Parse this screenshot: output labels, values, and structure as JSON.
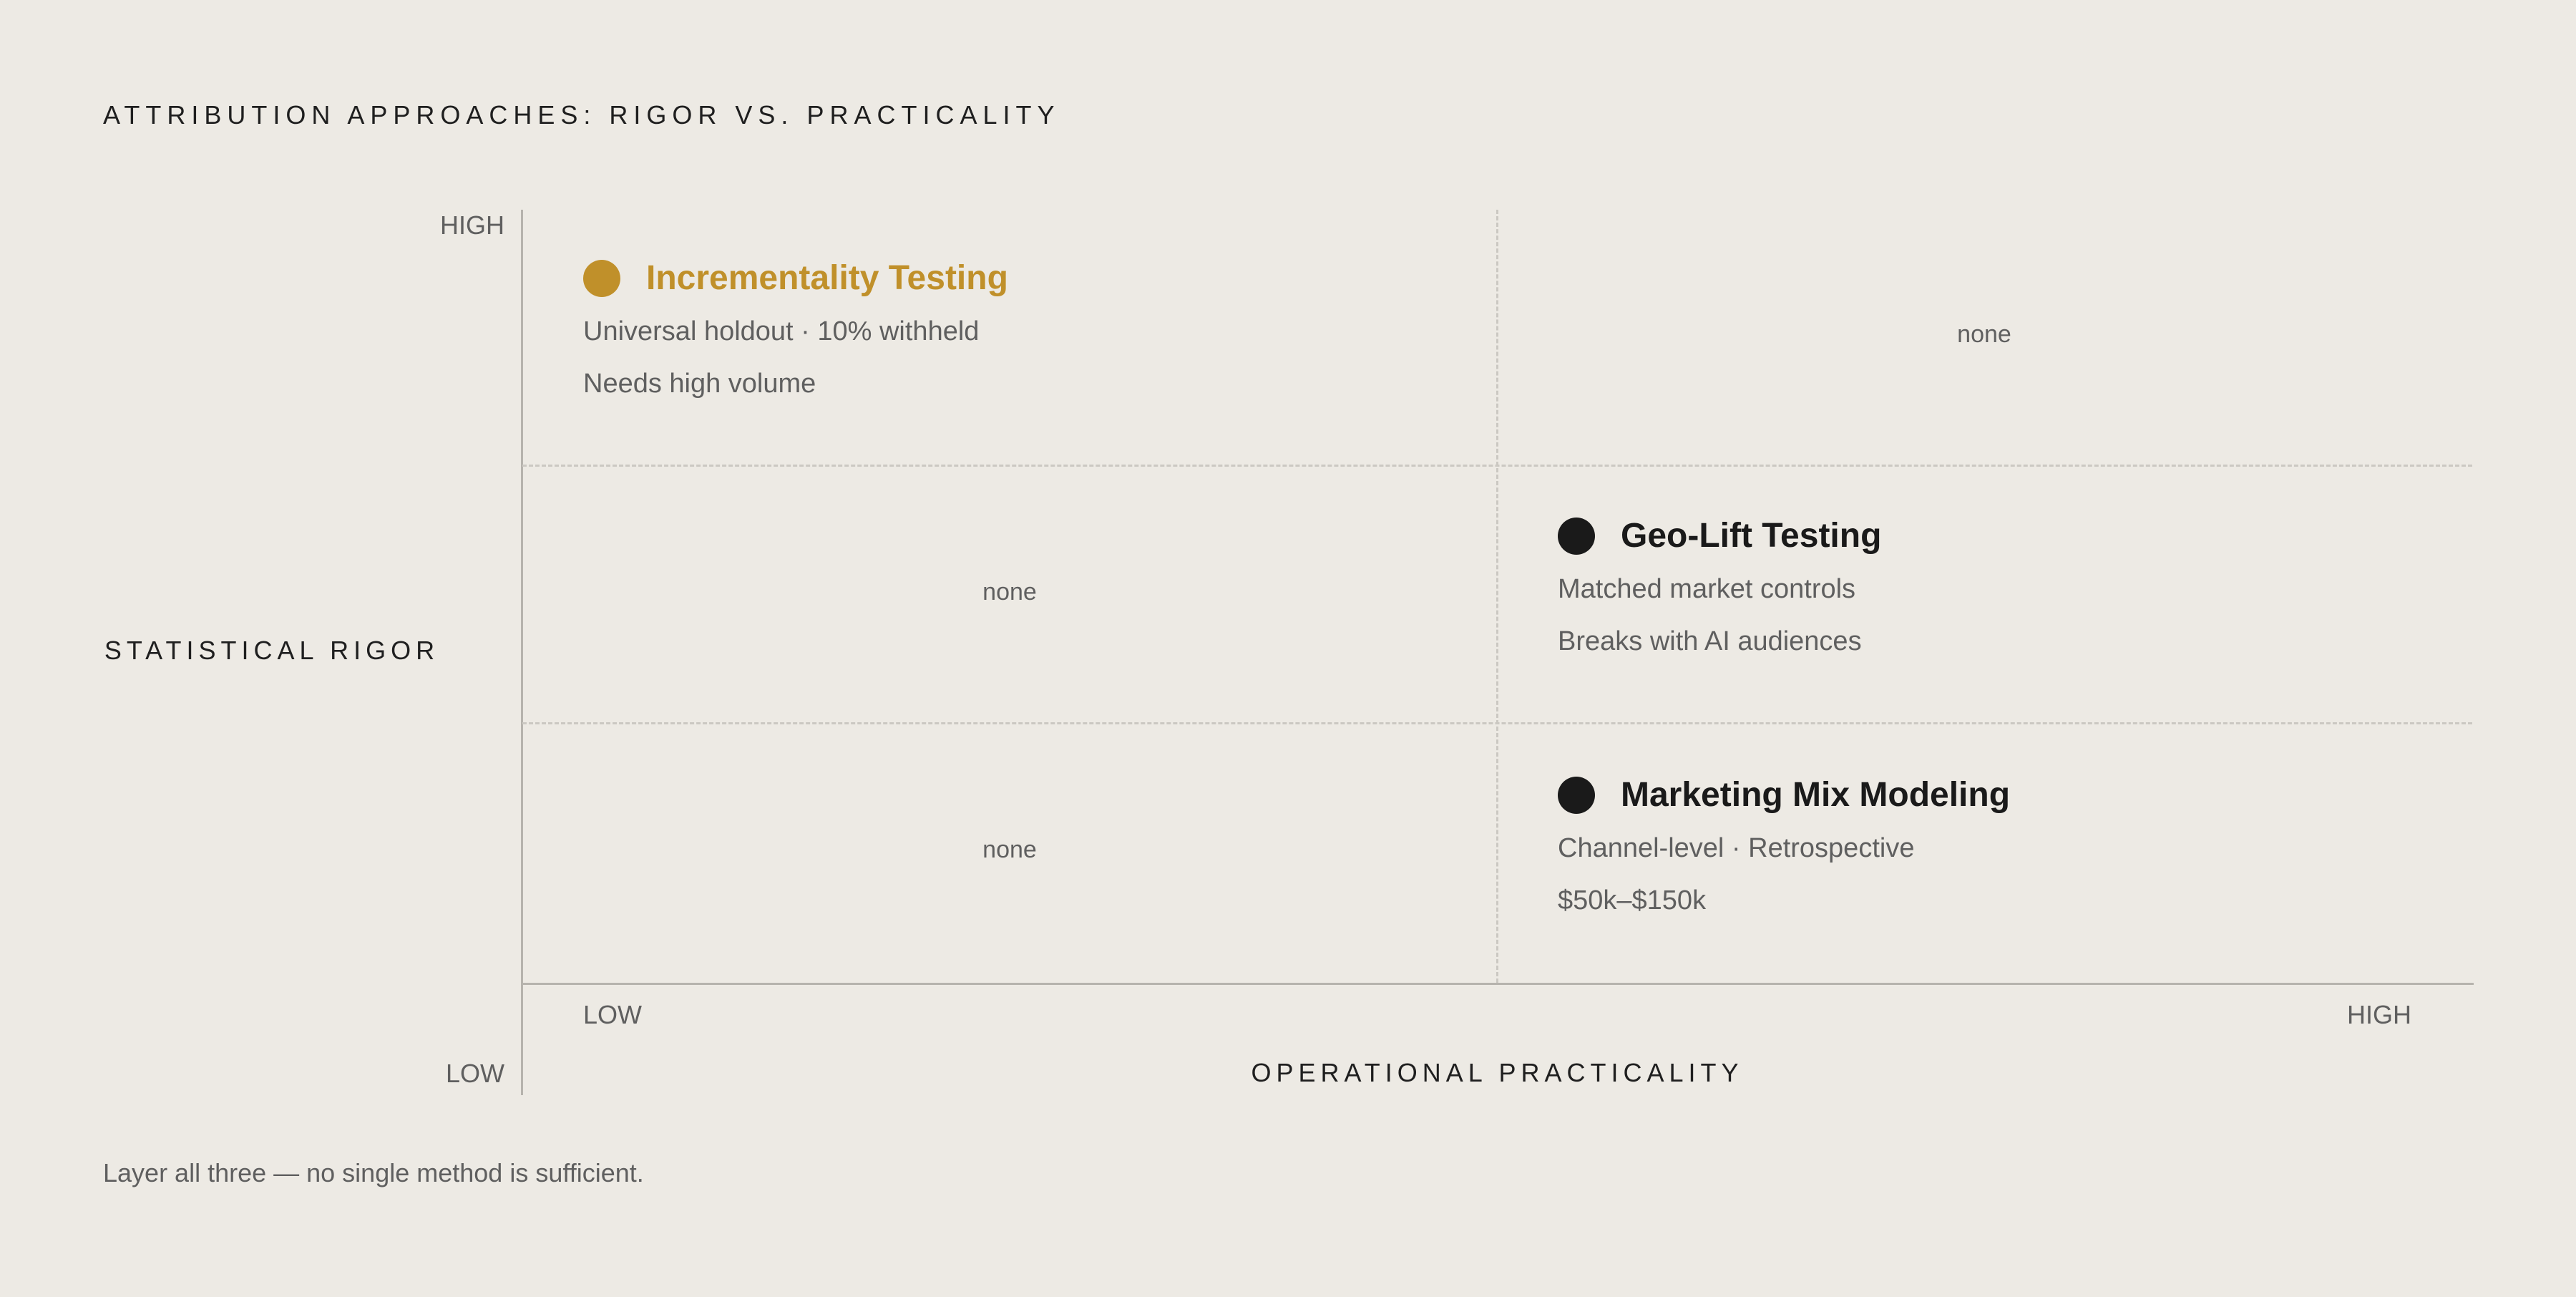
{
  "title": "ATTRIBUTION APPROACHES: RIGOR VS. PRACTICALITY",
  "y_axis": {
    "label": "STATISTICAL RIGOR",
    "high": "HIGH",
    "low": "LOW"
  },
  "x_axis": {
    "label": "OPERATIONAL PRACTICALITY",
    "low": "LOW",
    "high": "HIGH"
  },
  "empty_cell_text": "none",
  "items": [
    {
      "name": "Incrementality Testing",
      "line1": "Universal holdout · 10% withheld",
      "line2": "Needs high volume",
      "color": "#c0902a",
      "rigor": "high",
      "practicality": "low"
    },
    {
      "name": "Geo-Lift Testing",
      "line1": "Matched market controls",
      "line2": "Breaks with AI audiences",
      "color": "#1a1a1a",
      "rigor": "medium",
      "practicality": "high"
    },
    {
      "name": "Marketing Mix Modeling",
      "line1": "Channel-level · Retrospective",
      "line2": "$50k–$150k",
      "color": "#1a1a1a",
      "rigor": "low",
      "practicality": "high"
    }
  ],
  "footnote": "Layer all three — no single method is sufficient."
}
